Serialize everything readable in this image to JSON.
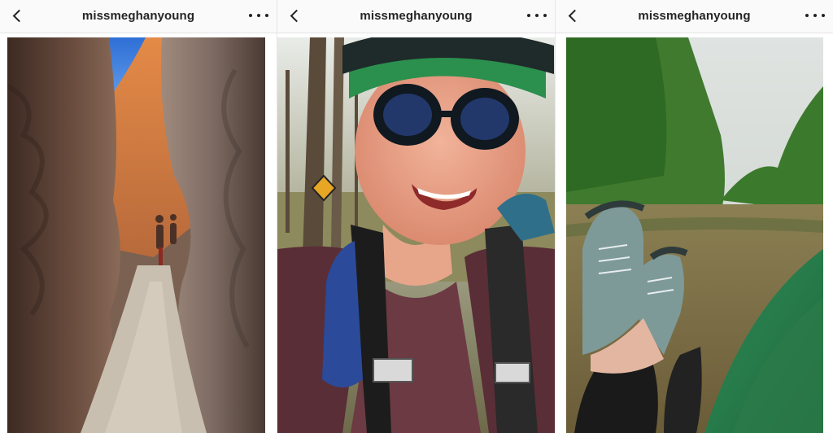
{
  "posts": [
    {
      "username": "missmeghanyoung",
      "photo": "slot-canyon-hikers-photo"
    },
    {
      "username": "missmeghanyoung",
      "photo": "selfie-helmet-sunglasses-photo"
    },
    {
      "username": "missmeghanyoung",
      "photo": "boat-feet-river-photo"
    }
  ],
  "icons": {
    "back": "chevron-left-icon",
    "more": "more-options-icon"
  },
  "colors": {
    "header_bg": "#fafafa",
    "text": "#262626",
    "divider": "#e3e3e3"
  }
}
